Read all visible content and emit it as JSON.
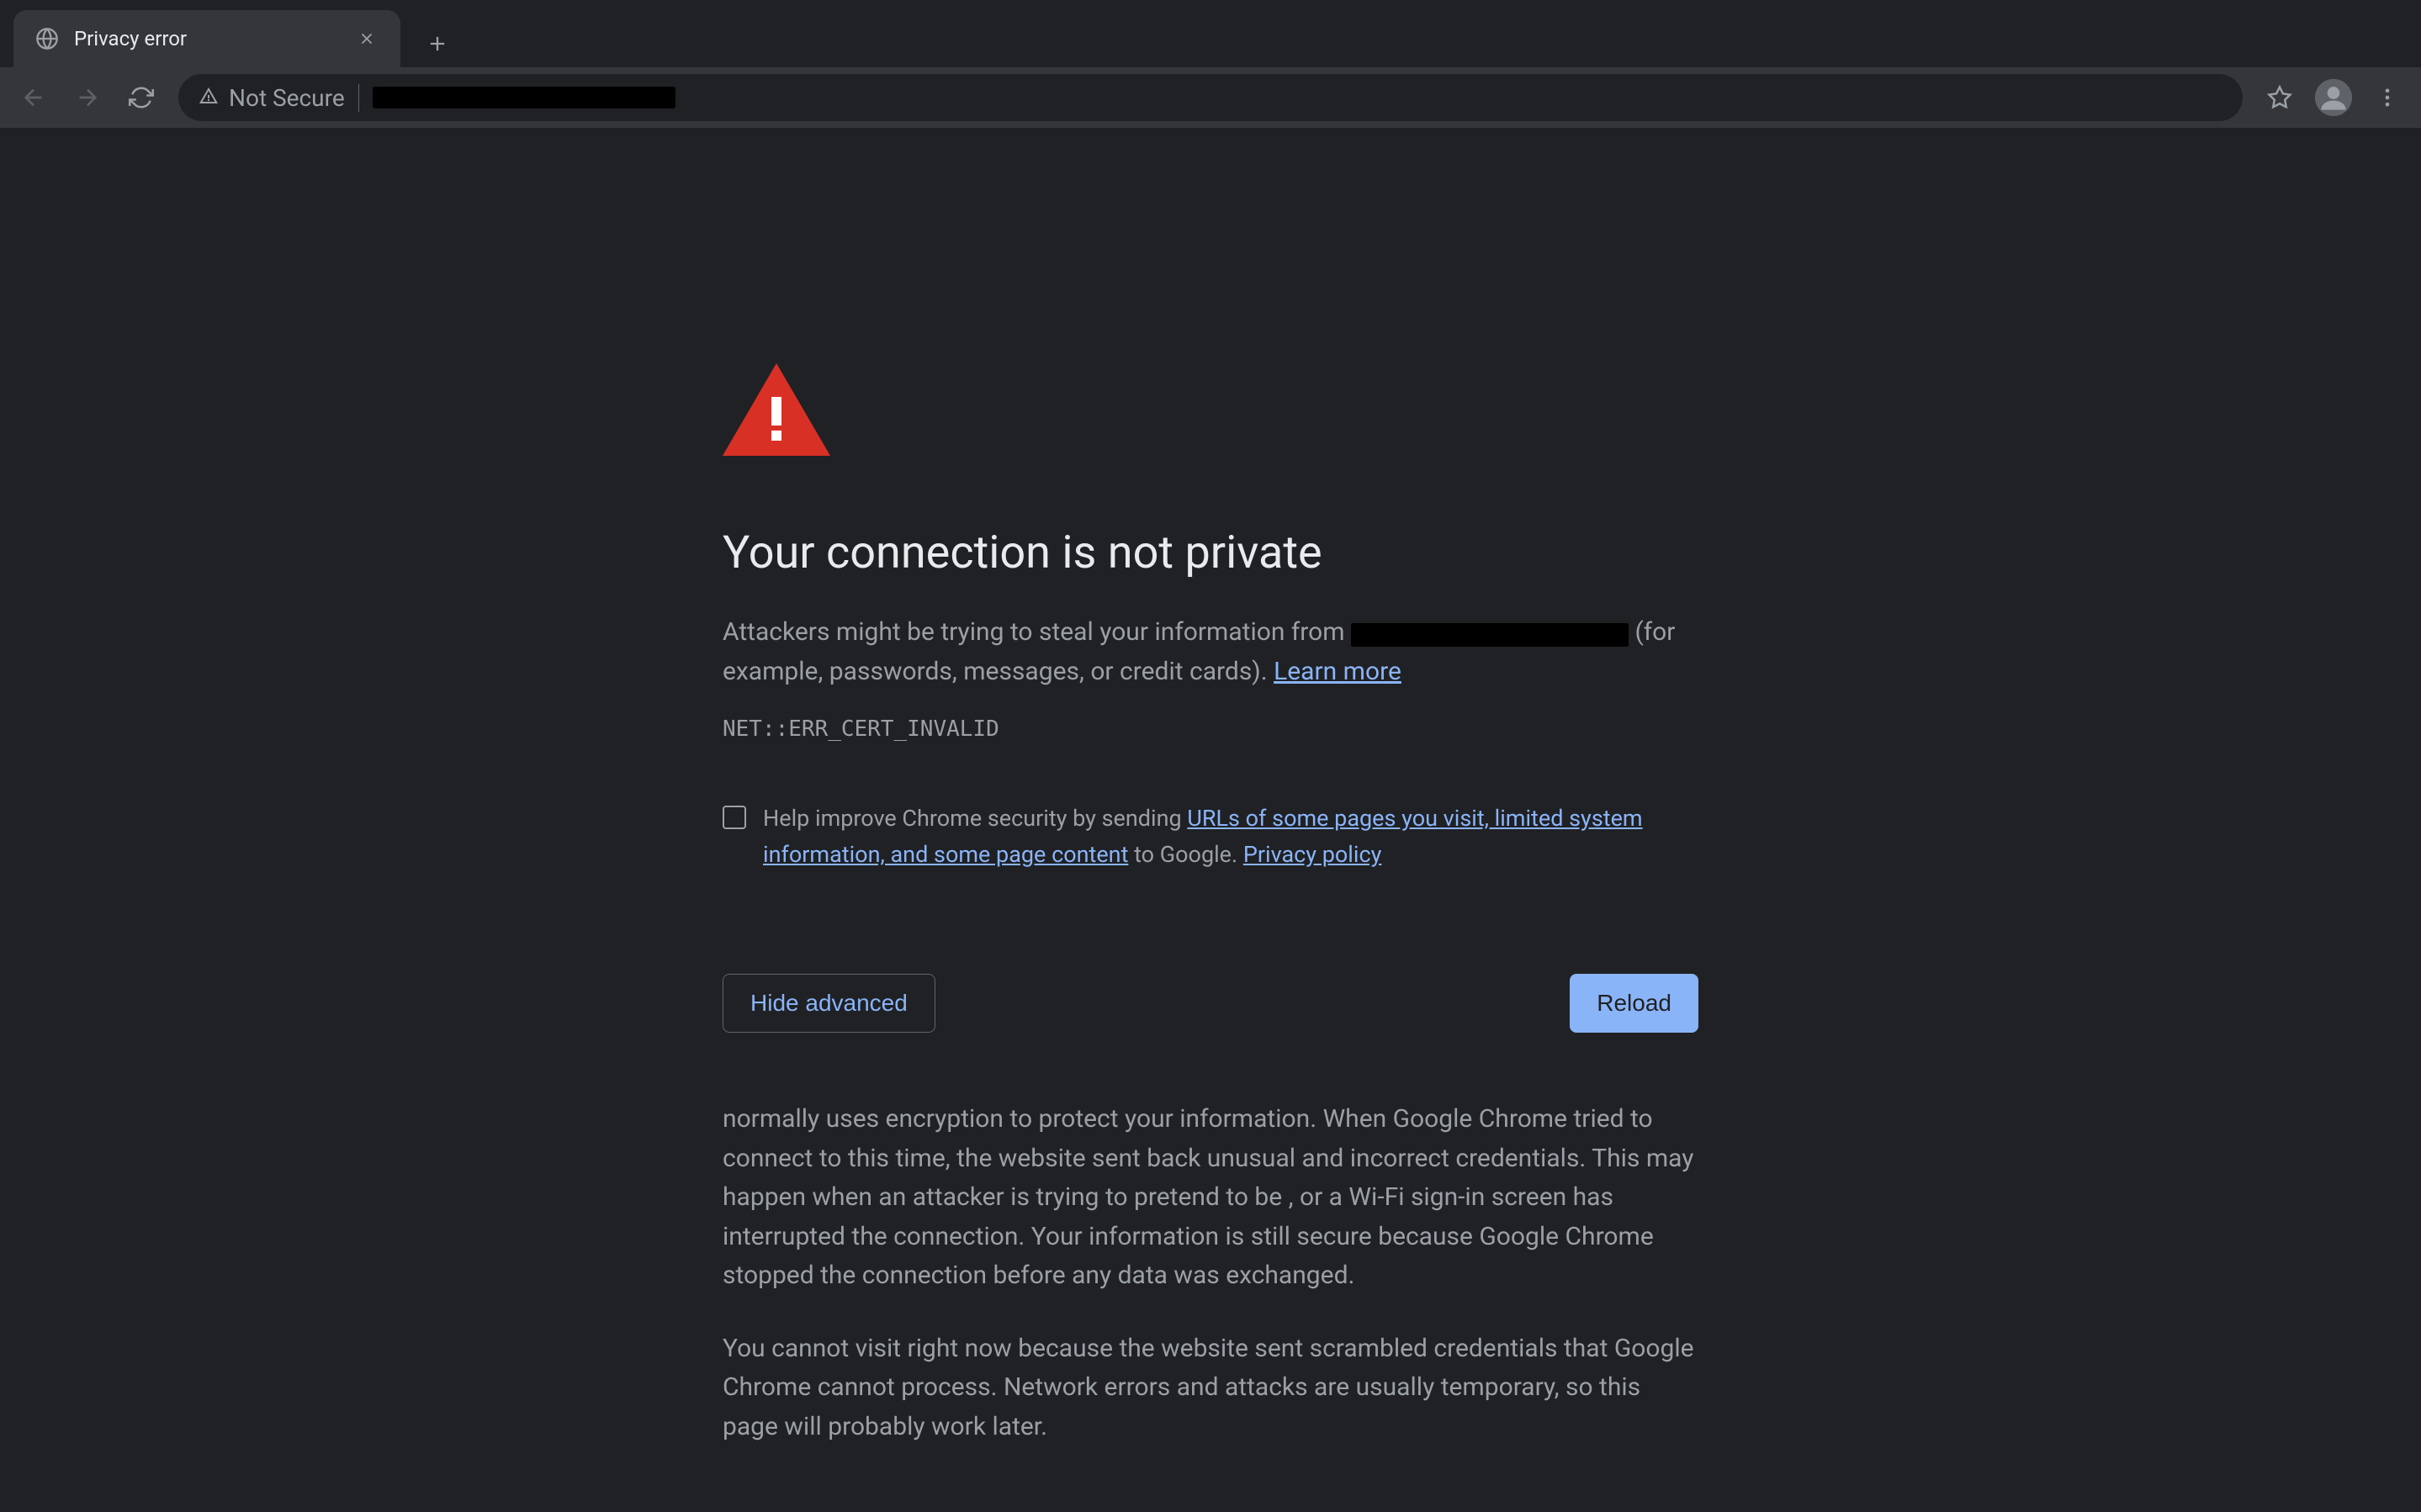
{
  "tab": {
    "title": "Privacy error"
  },
  "toolbar": {
    "security_label": "Not Secure"
  },
  "page": {
    "heading": "Your connection is not private",
    "body_prefix": "Attackers might be trying to steal your information from ",
    "body_suffix": " (for example, passwords, messages, or credit cards). ",
    "learn_more": "Learn more",
    "error_code": "NET::ERR_CERT_INVALID",
    "opt_in_prefix": "Help improve Chrome security by sending ",
    "opt_in_link": "URLs of some pages you visit, limited system information, and some page content",
    "opt_in_mid": " to Google. ",
    "privacy_policy": "Privacy policy",
    "hide_advanced": "Hide advanced",
    "reload": "Reload",
    "adv_p1_a": " normally uses encryption to protect your information. When Google Chrome tried to connect to ",
    "adv_p1_b": " this time, the website sent back unusual and incorrect credentials. This may happen when an attacker is trying to pretend to be ",
    "adv_p1_c": ", or a Wi-Fi sign-in screen has interrupted the connection. Your information is still secure because Google Chrome stopped the connection before any data was exchanged.",
    "adv_p2_a": "You cannot visit ",
    "adv_p2_b": " right now because the website sent scrambled credentials that Google Chrome cannot process. Network errors and attacks are usually temporary, so this page will probably work later."
  }
}
